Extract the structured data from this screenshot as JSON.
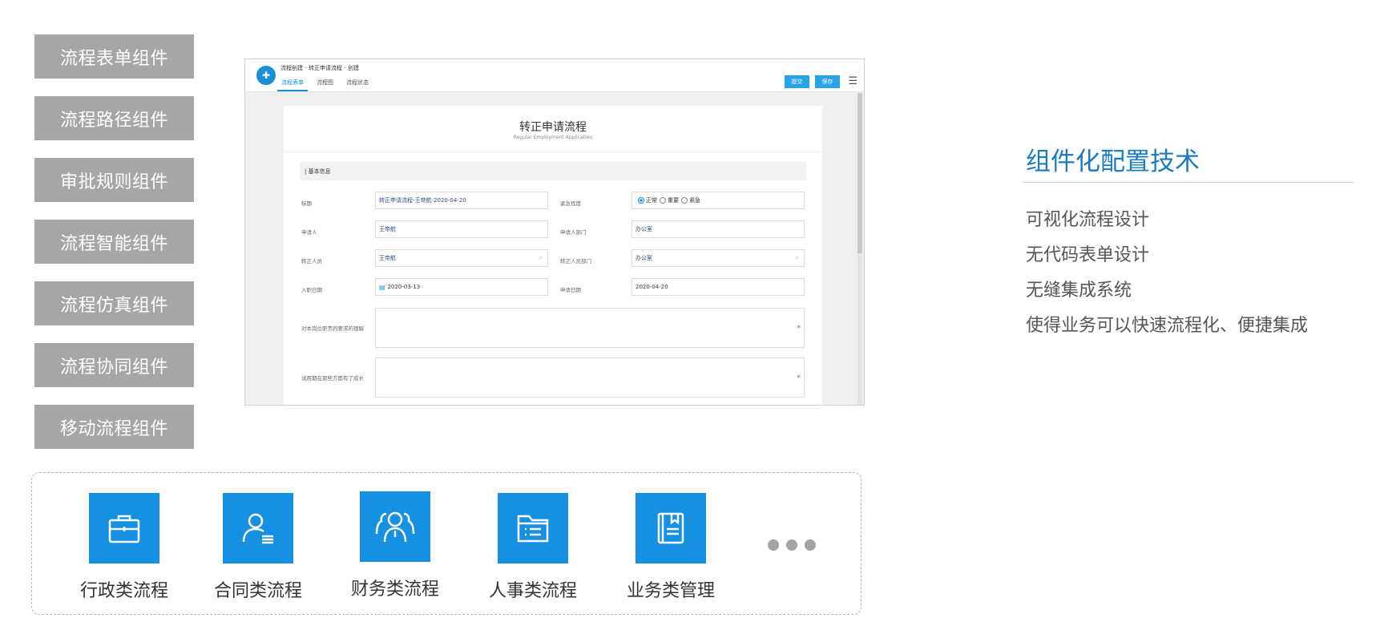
{
  "components": [
    {
      "label": "流程表单组件"
    },
    {
      "label": "流程路径组件"
    },
    {
      "label": "审批规则组件"
    },
    {
      "label": "流程智能组件"
    },
    {
      "label": "流程仿真组件"
    },
    {
      "label": "流程协同组件"
    },
    {
      "label": "移动流程组件"
    }
  ],
  "app": {
    "breadcrumb": "流程创建 - 转正申请流程 - 创建",
    "tabs": [
      "流程表单",
      "流程图",
      "流程状态"
    ],
    "submit_label": "提交",
    "save_label": "保存",
    "form_title": "转正申请流程",
    "form_subtitle": "Regular Employment Application",
    "section_label": "| 基本信息",
    "fields": {
      "title_label": "标题",
      "title_value": "转正申请流程-王帝航-2020-04-20",
      "urgency_label": "紧急程度",
      "urgency_options": [
        "正常",
        "重要",
        "紧急"
      ],
      "applicant_label": "申请人",
      "applicant_value": "王帝航",
      "applicant_dept_label": "申请人部门",
      "applicant_dept_value": "办公室",
      "regular_person_label": "转正人员",
      "regular_person_value": "王帝航",
      "regular_dept_label": "转正人员部门",
      "regular_dept_value": "办公室",
      "join_date_label": "入职日期",
      "join_date_value": "2020-03-13",
      "apply_date_label": "申请日期",
      "apply_date_value": "2020-04-20",
      "understanding_label": "对本岗位职责的要求的理解",
      "growth_label": "试用期在那些方面有了成长"
    },
    "required_mark": "*"
  },
  "right": {
    "title": "组件化配置技术",
    "features": [
      "可视化流程设计",
      "无代码表单设计",
      "无缝集成系统",
      "使得业务可以快速流程化、便捷集成"
    ]
  },
  "categories": [
    {
      "label": "行政类流程",
      "icon": "briefcase-icon"
    },
    {
      "label": "合同类流程",
      "icon": "user-doc-icon"
    },
    {
      "label": "财务类流程",
      "icon": "team-icon"
    },
    {
      "label": "人事类流程",
      "icon": "folder-list-icon"
    },
    {
      "label": "业务类管理",
      "icon": "notebook-icon"
    }
  ],
  "more_icon": "more-dots-icon",
  "colors": {
    "accent": "#1690e0",
    "button_gray": "#a6a6a6",
    "title_blue": "#1a7bbf"
  }
}
